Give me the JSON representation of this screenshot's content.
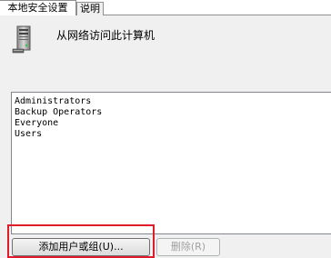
{
  "tabs": [
    {
      "label": "本地安全设置",
      "active": true
    },
    {
      "label": "说明",
      "active": false
    }
  ],
  "policy": {
    "title": "从网络访问此计算机",
    "icon": "server-icon"
  },
  "members": [
    "Administrators",
    "Backup Operators",
    "Everyone",
    "Users"
  ],
  "buttons": {
    "add_label": "添加用户或组(U)...",
    "remove_label": "删除(R)"
  },
  "colors": {
    "highlight": "#e01c2a",
    "panel_bg": "#f0f0f0"
  }
}
